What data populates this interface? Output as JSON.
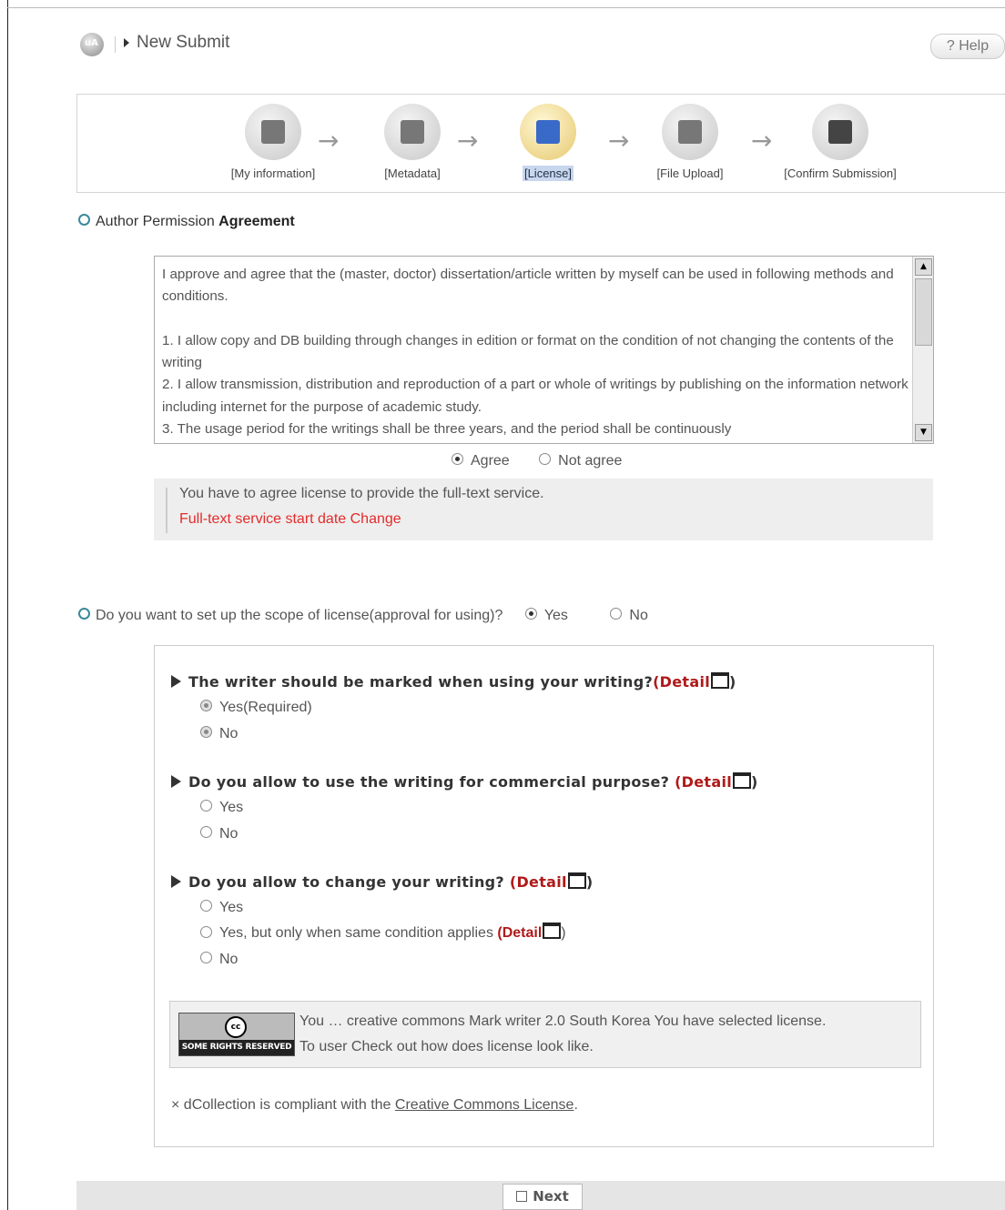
{
  "header": {
    "logo_text": "uA",
    "title": "New Submit",
    "help_label": "? Help"
  },
  "steps": [
    {
      "label": "[My information]",
      "active": false
    },
    {
      "label": "[Metadata]",
      "active": false
    },
    {
      "label": "[License]",
      "active": true
    },
    {
      "label": "[File Upload]",
      "active": false
    },
    {
      "label": "[Confirm Submission]",
      "active": false
    }
  ],
  "agreement": {
    "title_prefix": "Author Permission",
    "title_bold": "Agreement",
    "text": [
      "I approve and agree that the (master, doctor) dissertation/article written by myself can be used in following methods and conditions.",
      "",
      "1. I allow copy and DB building through changes in edition or format on the condition of not changing the contents of the writing",
      "2. I allow transmission, distribution and reproduction of a part or whole of writings by publishing on the information network including internet for the purpose of academic study.",
      "3. The usage period for the writings shall be three years, and the period shall be continuously"
    ],
    "agree_label": "Agree",
    "not_agree_label": "Not agree",
    "selected": "Agree",
    "notice_line1": "You have to agree license to provide the full-text service.",
    "notice_line2": "Full-text service start date Change"
  },
  "scope": {
    "question": "Do you want to set up the scope of license(approval for using)?",
    "yes_label": "Yes",
    "no_label": "No",
    "selected": "Yes"
  },
  "license": {
    "q1": {
      "text": "The writer should be marked when using your writing?",
      "detail": "(Detail",
      "paren": ")"
    },
    "q1_options": [
      "Yes(Required)",
      "No"
    ],
    "q2": {
      "text": "Do you allow to use the writing for commercial purpose? ",
      "detail": "(Detail",
      "paren": ")"
    },
    "q2_options": [
      "Yes",
      "No"
    ],
    "q3": {
      "text": "Do you allow to change your writing? ",
      "detail": "(Detail",
      "paren": ")"
    },
    "q3_options": [
      "Yes",
      "Yes, but only when same condition applies ",
      "No"
    ],
    "q3_option2_detail": "(Detail",
    "q3_option2_paren": ")",
    "cc_badge_symbol": "cc",
    "cc_badge_strip": "SOME RIGHTS RESERVED",
    "cc_line1": "You … creative commons Mark writer 2.0 South Korea You have selected license.",
    "cc_line2": "To user Check out how does license look like.",
    "note_prefix": "× dCollection is compliant with the ",
    "note_link": "Creative Commons License",
    "note_suffix": "."
  },
  "footer": {
    "next_label": "Next"
  }
}
